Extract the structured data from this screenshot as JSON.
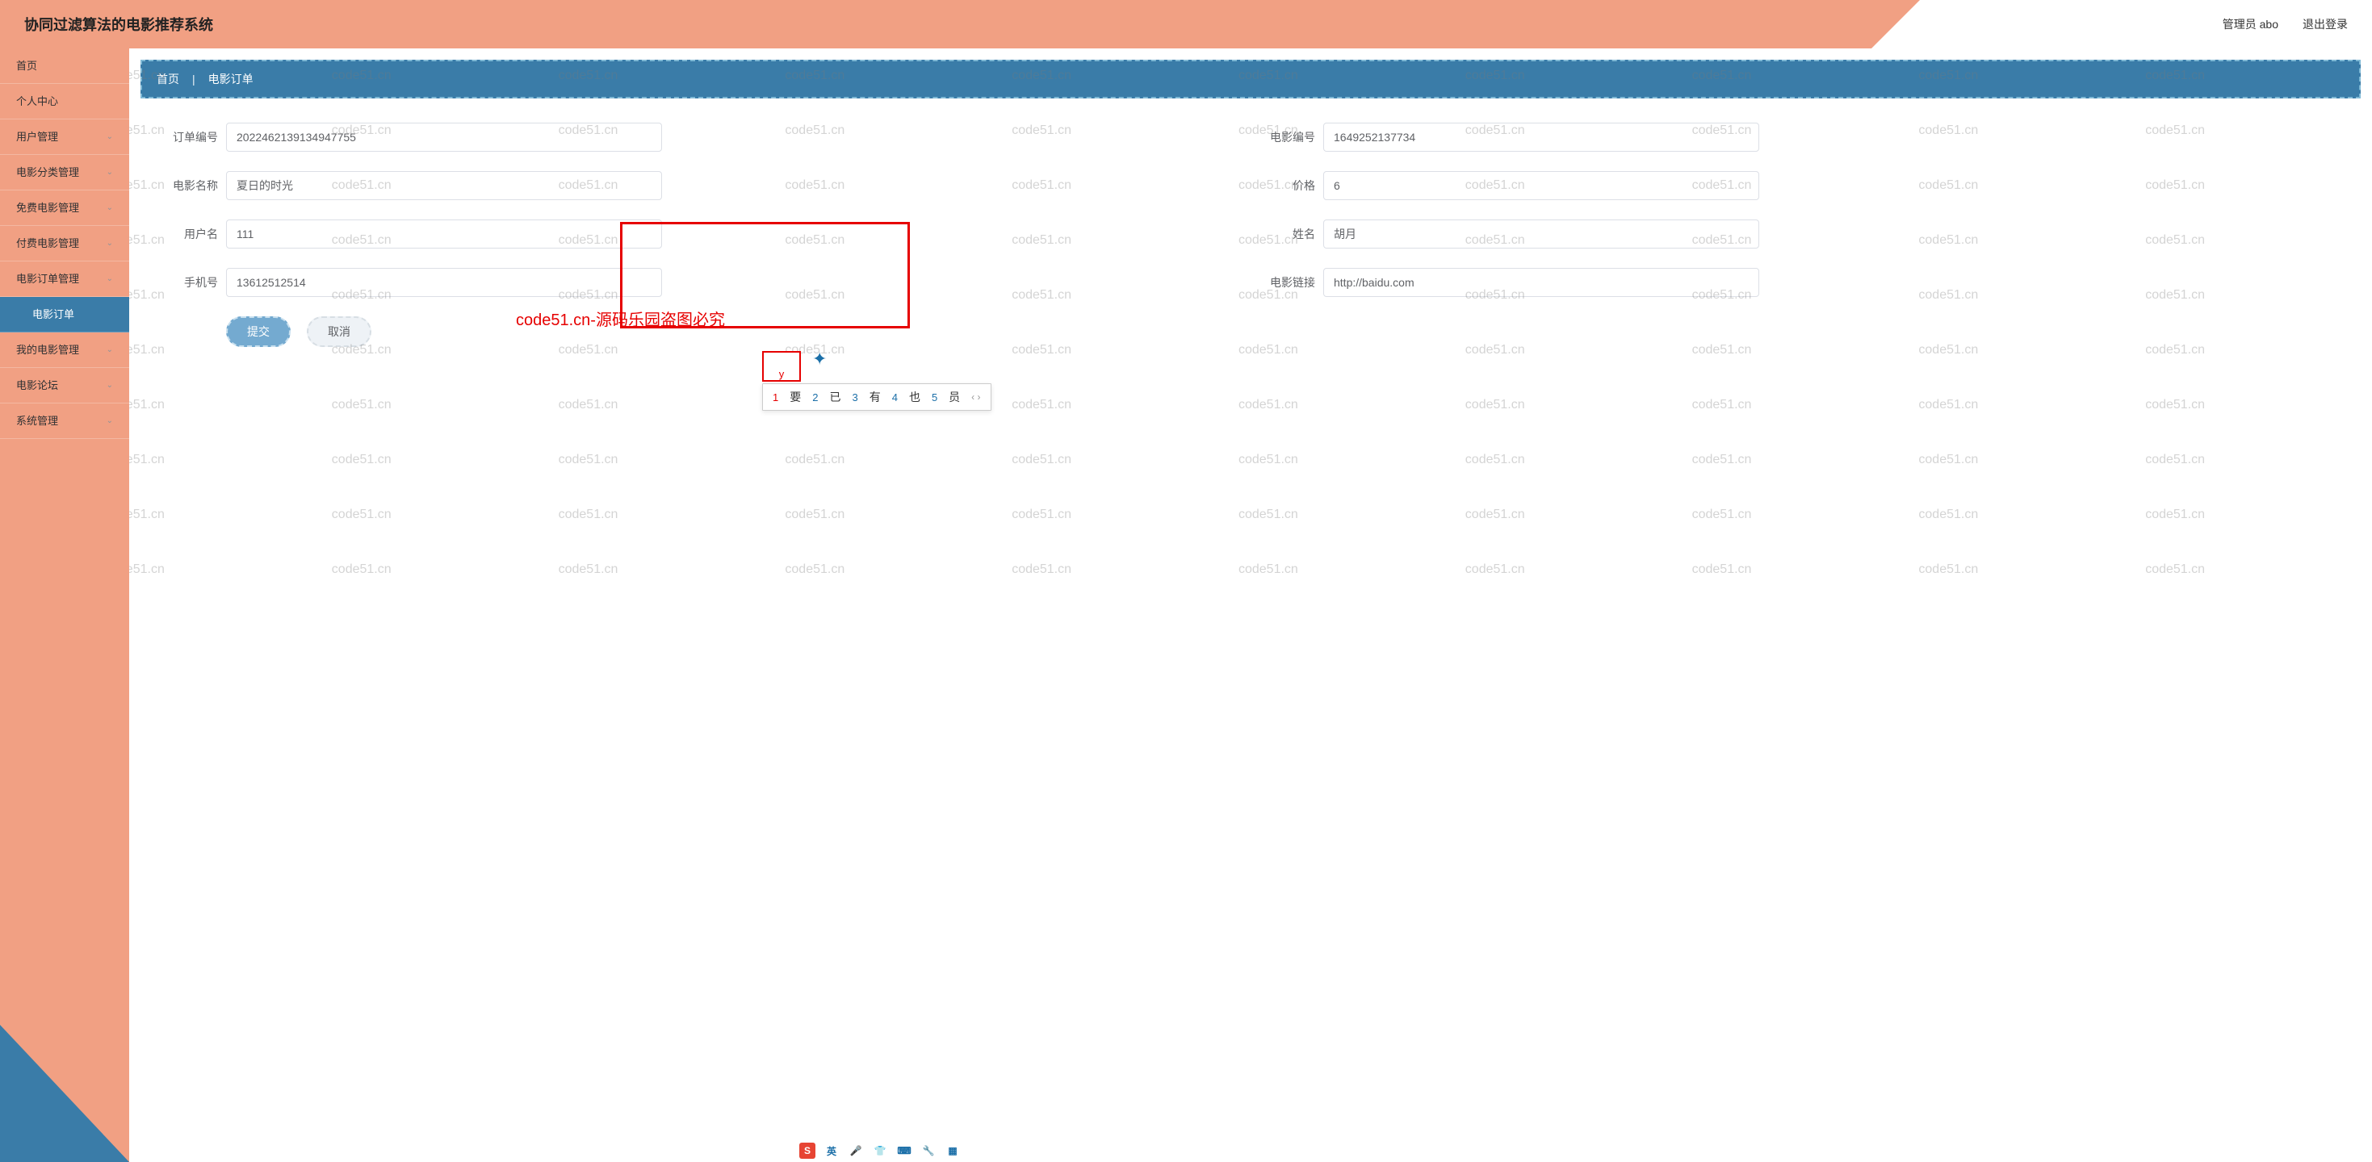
{
  "header": {
    "title": "协同过滤算法的电影推荐系统",
    "admin_label": "管理员 abo",
    "logout_label": "退出登录"
  },
  "sidebar": {
    "items": [
      {
        "label": "首页",
        "expandable": false
      },
      {
        "label": "个人中心",
        "expandable": false
      },
      {
        "label": "用户管理",
        "expandable": true
      },
      {
        "label": "电影分类管理",
        "expandable": true
      },
      {
        "label": "免费电影管理",
        "expandable": true
      },
      {
        "label": "付费电影管理",
        "expandable": true
      },
      {
        "label": "电影订单管理",
        "expandable": true
      }
    ],
    "sub_active": "电影订单",
    "tail": [
      {
        "label": "我的电影管理",
        "expandable": true
      },
      {
        "label": "电影论坛",
        "expandable": true
      },
      {
        "label": "系统管理",
        "expandable": true
      }
    ]
  },
  "breadcrumb": {
    "home": "首页",
    "current": "电影订单"
  },
  "form": {
    "order_no": {
      "label": "订单编号",
      "value": "2022462139134947755"
    },
    "movie_no": {
      "label": "电影编号",
      "value": "1649252137734"
    },
    "movie_name": {
      "label": "电影名称",
      "value": "夏日的时光"
    },
    "price": {
      "label": "价格",
      "value": "6"
    },
    "username": {
      "label": "用户名",
      "value": "111"
    },
    "realname": {
      "label": "姓名",
      "value": "胡月"
    },
    "phone": {
      "label": "手机号",
      "value": "13612512514"
    },
    "movie_link": {
      "label": "电影链接",
      "value": "http://baidu.com"
    }
  },
  "buttons": {
    "submit": "提交",
    "cancel": "取消"
  },
  "watermark_text": "code51.cn",
  "annotation_text": "code51.cn-源码乐园盗图必究",
  "ime": {
    "typed": "y",
    "candidates": [
      {
        "num": "1",
        "word": "要"
      },
      {
        "num": "2",
        "word": "已"
      },
      {
        "num": "3",
        "word": "有"
      },
      {
        "num": "4",
        "word": "也"
      },
      {
        "num": "5",
        "word": "员"
      }
    ]
  },
  "sogou": {
    "lang": "英"
  }
}
